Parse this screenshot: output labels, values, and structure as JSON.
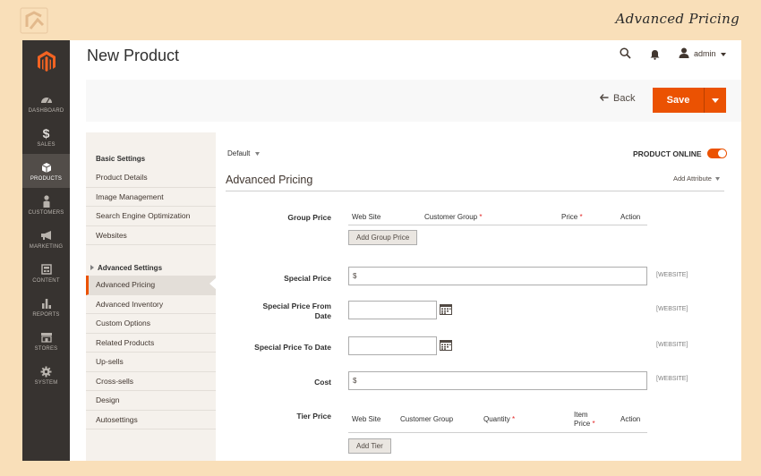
{
  "banner": {
    "title": "Advanced Pricing"
  },
  "sidebar": {
    "items": [
      {
        "label": "DASHBOARD",
        "icon": "dashboard-icon"
      },
      {
        "label": "SALES",
        "icon": "dollar-icon"
      },
      {
        "label": "PRODUCTS",
        "icon": "cube-icon"
      },
      {
        "label": "CUSTOMERS",
        "icon": "person-icon"
      },
      {
        "label": "MARKETING",
        "icon": "megaphone-icon"
      },
      {
        "label": "CONTENT",
        "icon": "content-icon"
      },
      {
        "label": "REPORTS",
        "icon": "bar-chart-icon"
      },
      {
        "label": "STORES",
        "icon": "store-icon"
      },
      {
        "label": "SYSTEM",
        "icon": "gear-icon"
      }
    ],
    "active": "PRODUCTS"
  },
  "header": {
    "title": "New Product",
    "user": "admin"
  },
  "actions": {
    "back": "Back",
    "save": "Save"
  },
  "panel": {
    "basic_heading": "Basic Settings",
    "basic_items": [
      "Product Details",
      "Image Management",
      "Search Engine Optimization",
      "Websites"
    ],
    "advanced_heading": "Advanced Settings",
    "advanced_items": [
      "Advanced Pricing",
      "Advanced Inventory",
      "Custom Options",
      "Related Products",
      "Up-sells",
      "Cross-sells",
      "Design",
      "Autosettings"
    ],
    "active": "Advanced Pricing"
  },
  "content": {
    "scope": "Default",
    "product_online": "PRODUCT ONLINE",
    "section_title": "Advanced Pricing",
    "add_attribute": "Add Attribute",
    "group_price": {
      "label": "Group Price",
      "columns": [
        "Web Site",
        "Customer Group",
        "Price",
        "Action"
      ],
      "required": [
        false,
        true,
        true,
        false
      ],
      "button": "Add Group Price"
    },
    "special_price": {
      "label": "Special Price",
      "value": "$",
      "scope": "[WEBSITE]"
    },
    "special_from": {
      "label_line1": "Special Price From",
      "label_line2": "Date",
      "scope": "[WEBSITE]"
    },
    "special_to": {
      "label": "Special Price To Date",
      "scope": "[WEBSITE]"
    },
    "cost": {
      "label": "Cost",
      "value": "$",
      "scope": "[WEBSITE]"
    },
    "tier_price": {
      "label": "Tier Price",
      "columns": [
        "Web Site",
        "Customer Group",
        "Quantity",
        "Item",
        "Price",
        "Action"
      ],
      "button": "Add Tier"
    }
  },
  "colors": {
    "accent": "#eb5202",
    "sidebar": "#373330",
    "panel": "#f5f1ec",
    "banner": "#f9dfb9"
  }
}
